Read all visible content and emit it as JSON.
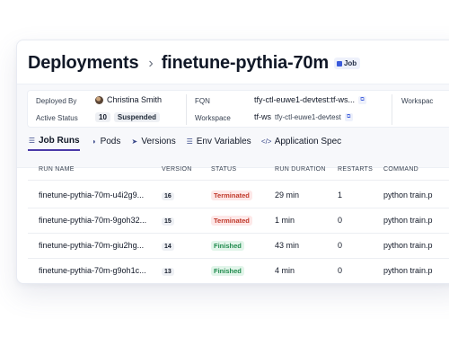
{
  "header": {
    "title": "Deployments",
    "separator": "›",
    "subtitle": "finetune-pythia-70m",
    "type_badge": "Job"
  },
  "info": {
    "deployed_by_label": "Deployed By",
    "deployed_by_value": "Christina Smith",
    "active_status_label": "Active Status",
    "active_status_count": "10",
    "active_status_value": "Suspended",
    "fqn_label": "FQN",
    "fqn_value": "tfy-ctl-euwe1-devtest:tf-ws...",
    "workspace_label": "Workspace",
    "workspace_value": "tf-ws",
    "workspace_cluster": "tfy-ctl-euwe1-devtest",
    "workspace_right_label": "Workspac"
  },
  "tabs": [
    {
      "label": "Job Runs",
      "icon": "list-icon",
      "glyph": "☰",
      "active": true
    },
    {
      "label": "Pods",
      "icon": "pods-icon",
      "glyph": "◑",
      "active": false
    },
    {
      "label": "Versions",
      "icon": "rocket-icon",
      "glyph": "➤",
      "active": false
    },
    {
      "label": "Env Variables",
      "icon": "list-icon",
      "glyph": "☰",
      "active": false
    },
    {
      "label": "Application Spec",
      "icon": "code-icon",
      "glyph": "</>",
      "active": false
    }
  ],
  "table": {
    "columns": [
      "RUN NAME",
      "VERSION",
      "STATUS",
      "RUN DURATION",
      "RESTARTS",
      "COMMAND"
    ],
    "rows": [
      {
        "run_name": "finetune-pythia-70m-u4i2g9...",
        "version": "16",
        "status": "Terminated",
        "duration": "29 min",
        "restarts": "1",
        "command": "python train.p"
      },
      {
        "run_name": "finetune-pythia-70m-9goh32...",
        "version": "15",
        "status": "Terminated",
        "duration": "1 min",
        "restarts": "0",
        "command": "python train.p"
      },
      {
        "run_name": "finetune-pythia-70m-giu2hg...",
        "version": "14",
        "status": "Finished",
        "duration": "43 min",
        "restarts": "0",
        "command": "python train.p"
      },
      {
        "run_name": "finetune-pythia-70m-g9oh1c...",
        "version": "13",
        "status": "Finished",
        "duration": "4 min",
        "restarts": "0",
        "command": "python train.p"
      }
    ]
  },
  "colors": {
    "tab_underline": "#4a3aa8",
    "terminated_bg": "#fde8e8",
    "terminated_text": "#c0392b",
    "finished_bg": "#e2f5ea",
    "finished_text": "#1f8a4c"
  }
}
